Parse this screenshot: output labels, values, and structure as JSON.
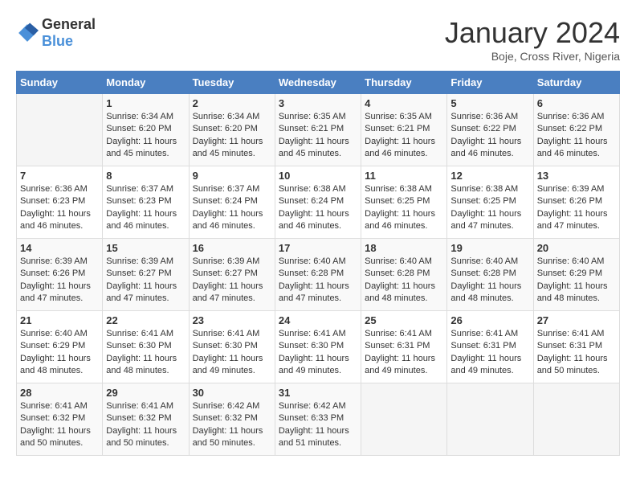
{
  "logo": {
    "general": "General",
    "blue": "Blue"
  },
  "title": "January 2024",
  "location": "Boje, Cross River, Nigeria",
  "days_of_week": [
    "Sunday",
    "Monday",
    "Tuesday",
    "Wednesday",
    "Thursday",
    "Friday",
    "Saturday"
  ],
  "weeks": [
    [
      {
        "day": "",
        "sunrise": "",
        "sunset": "",
        "daylight": ""
      },
      {
        "day": "1",
        "sunrise": "Sunrise: 6:34 AM",
        "sunset": "Sunset: 6:20 PM",
        "daylight": "Daylight: 11 hours and 45 minutes."
      },
      {
        "day": "2",
        "sunrise": "Sunrise: 6:34 AM",
        "sunset": "Sunset: 6:20 PM",
        "daylight": "Daylight: 11 hours and 45 minutes."
      },
      {
        "day": "3",
        "sunrise": "Sunrise: 6:35 AM",
        "sunset": "Sunset: 6:21 PM",
        "daylight": "Daylight: 11 hours and 45 minutes."
      },
      {
        "day": "4",
        "sunrise": "Sunrise: 6:35 AM",
        "sunset": "Sunset: 6:21 PM",
        "daylight": "Daylight: 11 hours and 46 minutes."
      },
      {
        "day": "5",
        "sunrise": "Sunrise: 6:36 AM",
        "sunset": "Sunset: 6:22 PM",
        "daylight": "Daylight: 11 hours and 46 minutes."
      },
      {
        "day": "6",
        "sunrise": "Sunrise: 6:36 AM",
        "sunset": "Sunset: 6:22 PM",
        "daylight": "Daylight: 11 hours and 46 minutes."
      }
    ],
    [
      {
        "day": "7",
        "sunrise": "Sunrise: 6:36 AM",
        "sunset": "Sunset: 6:23 PM",
        "daylight": "Daylight: 11 hours and 46 minutes."
      },
      {
        "day": "8",
        "sunrise": "Sunrise: 6:37 AM",
        "sunset": "Sunset: 6:23 PM",
        "daylight": "Daylight: 11 hours and 46 minutes."
      },
      {
        "day": "9",
        "sunrise": "Sunrise: 6:37 AM",
        "sunset": "Sunset: 6:24 PM",
        "daylight": "Daylight: 11 hours and 46 minutes."
      },
      {
        "day": "10",
        "sunrise": "Sunrise: 6:38 AM",
        "sunset": "Sunset: 6:24 PM",
        "daylight": "Daylight: 11 hours and 46 minutes."
      },
      {
        "day": "11",
        "sunrise": "Sunrise: 6:38 AM",
        "sunset": "Sunset: 6:25 PM",
        "daylight": "Daylight: 11 hours and 46 minutes."
      },
      {
        "day": "12",
        "sunrise": "Sunrise: 6:38 AM",
        "sunset": "Sunset: 6:25 PM",
        "daylight": "Daylight: 11 hours and 47 minutes."
      },
      {
        "day": "13",
        "sunrise": "Sunrise: 6:39 AM",
        "sunset": "Sunset: 6:26 PM",
        "daylight": "Daylight: 11 hours and 47 minutes."
      }
    ],
    [
      {
        "day": "14",
        "sunrise": "Sunrise: 6:39 AM",
        "sunset": "Sunset: 6:26 PM",
        "daylight": "Daylight: 11 hours and 47 minutes."
      },
      {
        "day": "15",
        "sunrise": "Sunrise: 6:39 AM",
        "sunset": "Sunset: 6:27 PM",
        "daylight": "Daylight: 11 hours and 47 minutes."
      },
      {
        "day": "16",
        "sunrise": "Sunrise: 6:39 AM",
        "sunset": "Sunset: 6:27 PM",
        "daylight": "Daylight: 11 hours and 47 minutes."
      },
      {
        "day": "17",
        "sunrise": "Sunrise: 6:40 AM",
        "sunset": "Sunset: 6:28 PM",
        "daylight": "Daylight: 11 hours and 47 minutes."
      },
      {
        "day": "18",
        "sunrise": "Sunrise: 6:40 AM",
        "sunset": "Sunset: 6:28 PM",
        "daylight": "Daylight: 11 hours and 48 minutes."
      },
      {
        "day": "19",
        "sunrise": "Sunrise: 6:40 AM",
        "sunset": "Sunset: 6:28 PM",
        "daylight": "Daylight: 11 hours and 48 minutes."
      },
      {
        "day": "20",
        "sunrise": "Sunrise: 6:40 AM",
        "sunset": "Sunset: 6:29 PM",
        "daylight": "Daylight: 11 hours and 48 minutes."
      }
    ],
    [
      {
        "day": "21",
        "sunrise": "Sunrise: 6:40 AM",
        "sunset": "Sunset: 6:29 PM",
        "daylight": "Daylight: 11 hours and 48 minutes."
      },
      {
        "day": "22",
        "sunrise": "Sunrise: 6:41 AM",
        "sunset": "Sunset: 6:30 PM",
        "daylight": "Daylight: 11 hours and 48 minutes."
      },
      {
        "day": "23",
        "sunrise": "Sunrise: 6:41 AM",
        "sunset": "Sunset: 6:30 PM",
        "daylight": "Daylight: 11 hours and 49 minutes."
      },
      {
        "day": "24",
        "sunrise": "Sunrise: 6:41 AM",
        "sunset": "Sunset: 6:30 PM",
        "daylight": "Daylight: 11 hours and 49 minutes."
      },
      {
        "day": "25",
        "sunrise": "Sunrise: 6:41 AM",
        "sunset": "Sunset: 6:31 PM",
        "daylight": "Daylight: 11 hours and 49 minutes."
      },
      {
        "day": "26",
        "sunrise": "Sunrise: 6:41 AM",
        "sunset": "Sunset: 6:31 PM",
        "daylight": "Daylight: 11 hours and 49 minutes."
      },
      {
        "day": "27",
        "sunrise": "Sunrise: 6:41 AM",
        "sunset": "Sunset: 6:31 PM",
        "daylight": "Daylight: 11 hours and 50 minutes."
      }
    ],
    [
      {
        "day": "28",
        "sunrise": "Sunrise: 6:41 AM",
        "sunset": "Sunset: 6:32 PM",
        "daylight": "Daylight: 11 hours and 50 minutes."
      },
      {
        "day": "29",
        "sunrise": "Sunrise: 6:41 AM",
        "sunset": "Sunset: 6:32 PM",
        "daylight": "Daylight: 11 hours and 50 minutes."
      },
      {
        "day": "30",
        "sunrise": "Sunrise: 6:42 AM",
        "sunset": "Sunset: 6:32 PM",
        "daylight": "Daylight: 11 hours and 50 minutes."
      },
      {
        "day": "31",
        "sunrise": "Sunrise: 6:42 AM",
        "sunset": "Sunset: 6:33 PM",
        "daylight": "Daylight: 11 hours and 51 minutes."
      },
      {
        "day": "",
        "sunrise": "",
        "sunset": "",
        "daylight": ""
      },
      {
        "day": "",
        "sunrise": "",
        "sunset": "",
        "daylight": ""
      },
      {
        "day": "",
        "sunrise": "",
        "sunset": "",
        "daylight": ""
      }
    ]
  ]
}
